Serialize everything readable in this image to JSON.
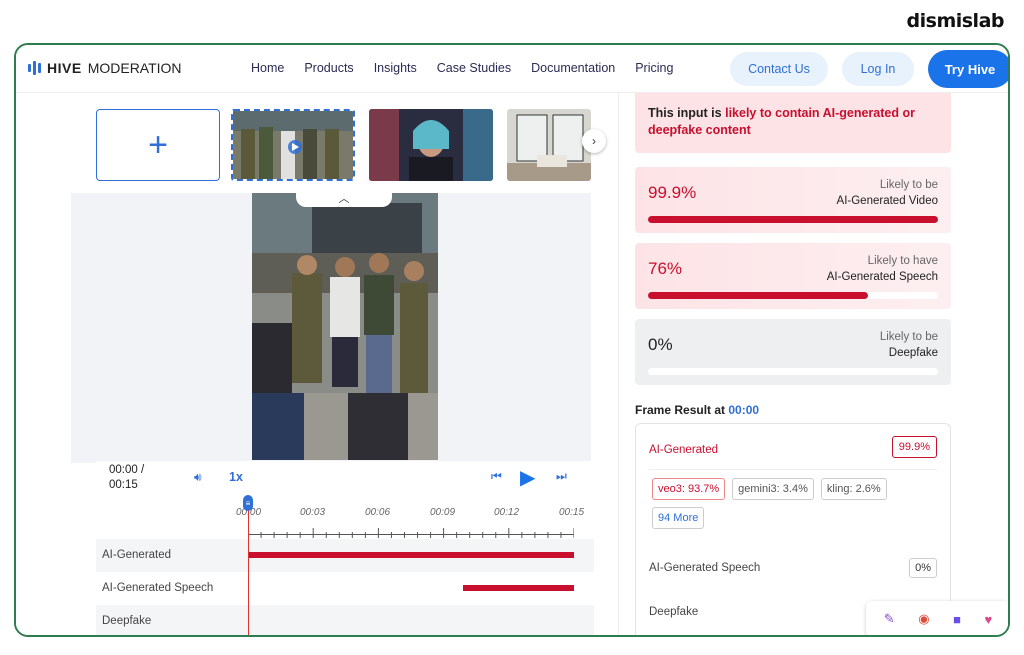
{
  "brand_mark": "dismislab",
  "nav": {
    "logo_bold": "HIVE",
    "logo_rest": "MODERATION",
    "links": [
      "Home",
      "Products",
      "Insights",
      "Case Studies",
      "Documentation",
      "Pricing"
    ],
    "contact": "Contact Us",
    "login": "Log In",
    "try": "Try Hive"
  },
  "player": {
    "time_current": "00:00 /",
    "time_total": "00:15",
    "speed": "1x",
    "ticks": [
      "00:00",
      "00:03",
      "00:06",
      "00:09",
      "00:12",
      "00:15"
    ],
    "rows": [
      {
        "label": "AI-Generated",
        "start": 0,
        "end": 1
      },
      {
        "label": "AI-Generated Speech",
        "start": 0.66,
        "end": 1
      },
      {
        "label": "Deepfake",
        "start": null,
        "end": null
      }
    ]
  },
  "results": {
    "alert_prefix": "This input is ",
    "alert_highlight": "likely to contain AI-generated or deepfake content",
    "cards": [
      {
        "pct": "99.9%",
        "l1": "Likely to be",
        "l2": "AI-Generated Video",
        "value": 0.999,
        "tone": "red"
      },
      {
        "pct": "76%",
        "l1": "Likely to have",
        "l2": "AI-Generated Speech",
        "value": 0.76,
        "tone": "red"
      },
      {
        "pct": "0%",
        "l1": "Likely to be",
        "l2": "Deepfake",
        "value": 0,
        "tone": "gray"
      }
    ],
    "frame_title": "Frame Result at ",
    "frame_time": "00:00",
    "frame_ai_label": "AI-Generated",
    "frame_ai_pct": "99.9%",
    "chips": [
      {
        "text": "veo3: 93.7%",
        "tone": "red"
      },
      {
        "text": "gemini3: 3.4%",
        "tone": "gray"
      },
      {
        "text": "kling: 2.6%",
        "tone": "gray"
      },
      {
        "text": "94 More",
        "tone": "blue"
      }
    ],
    "speech_label": "AI-Generated Speech",
    "speech_pct": "0%",
    "deepfake_label": "Deepfake"
  },
  "colors": {
    "accent": "#1a73e8",
    "danger": "#c8102e",
    "frame_border": "#2e7d4f"
  }
}
